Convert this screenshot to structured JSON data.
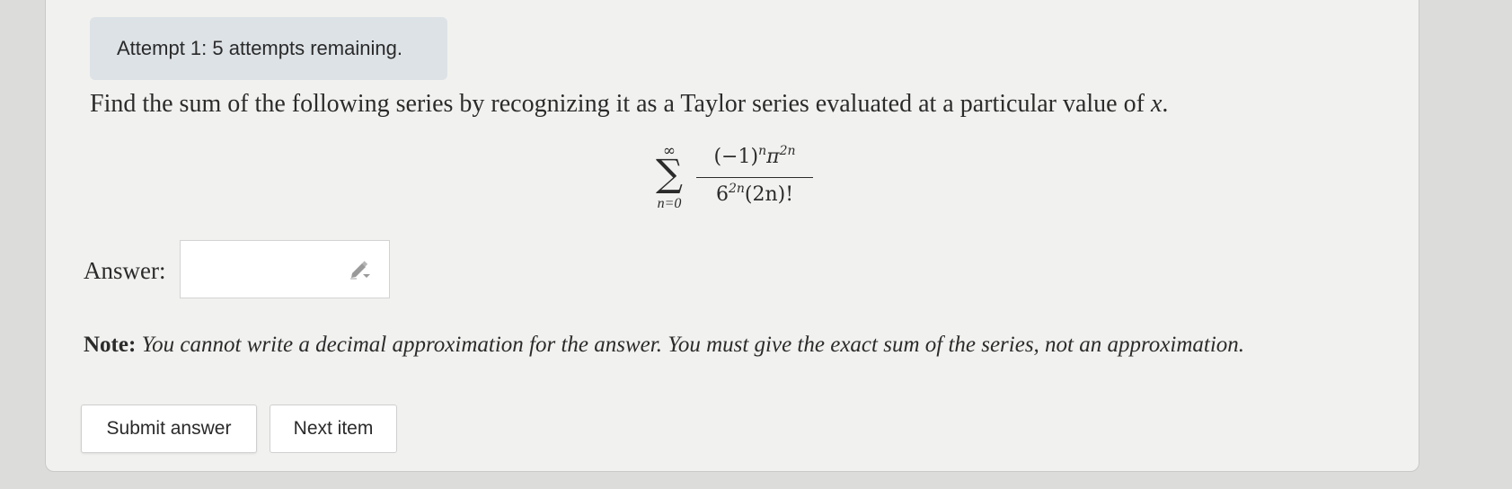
{
  "attempt": {
    "text": "Attempt 1: 5 attempts remaining."
  },
  "question": {
    "prefix": "Find the sum of the following series by recognizing it as a Taylor series evaluated at a particular value of ",
    "variable": "x",
    "suffix": "."
  },
  "formula": {
    "sum_upper": "∞",
    "sum_lower": "n=0",
    "numerator_base": "(−1)",
    "numerator_exp1": "n",
    "numerator_pi": "π",
    "numerator_exp2": "2n",
    "denominator_base": "6",
    "denominator_exp": "2n",
    "denominator_rest": "(2n)!"
  },
  "answer": {
    "label": "Answer:",
    "value": "",
    "tool_icon": "pencil-dropdown-icon"
  },
  "note": {
    "label": "Note:",
    "text": "You cannot write a decimal approximation for the answer. You must give the exact sum of the series, not an approximation."
  },
  "buttons": {
    "submit_label": "Submit answer",
    "next_label": "Next item"
  }
}
